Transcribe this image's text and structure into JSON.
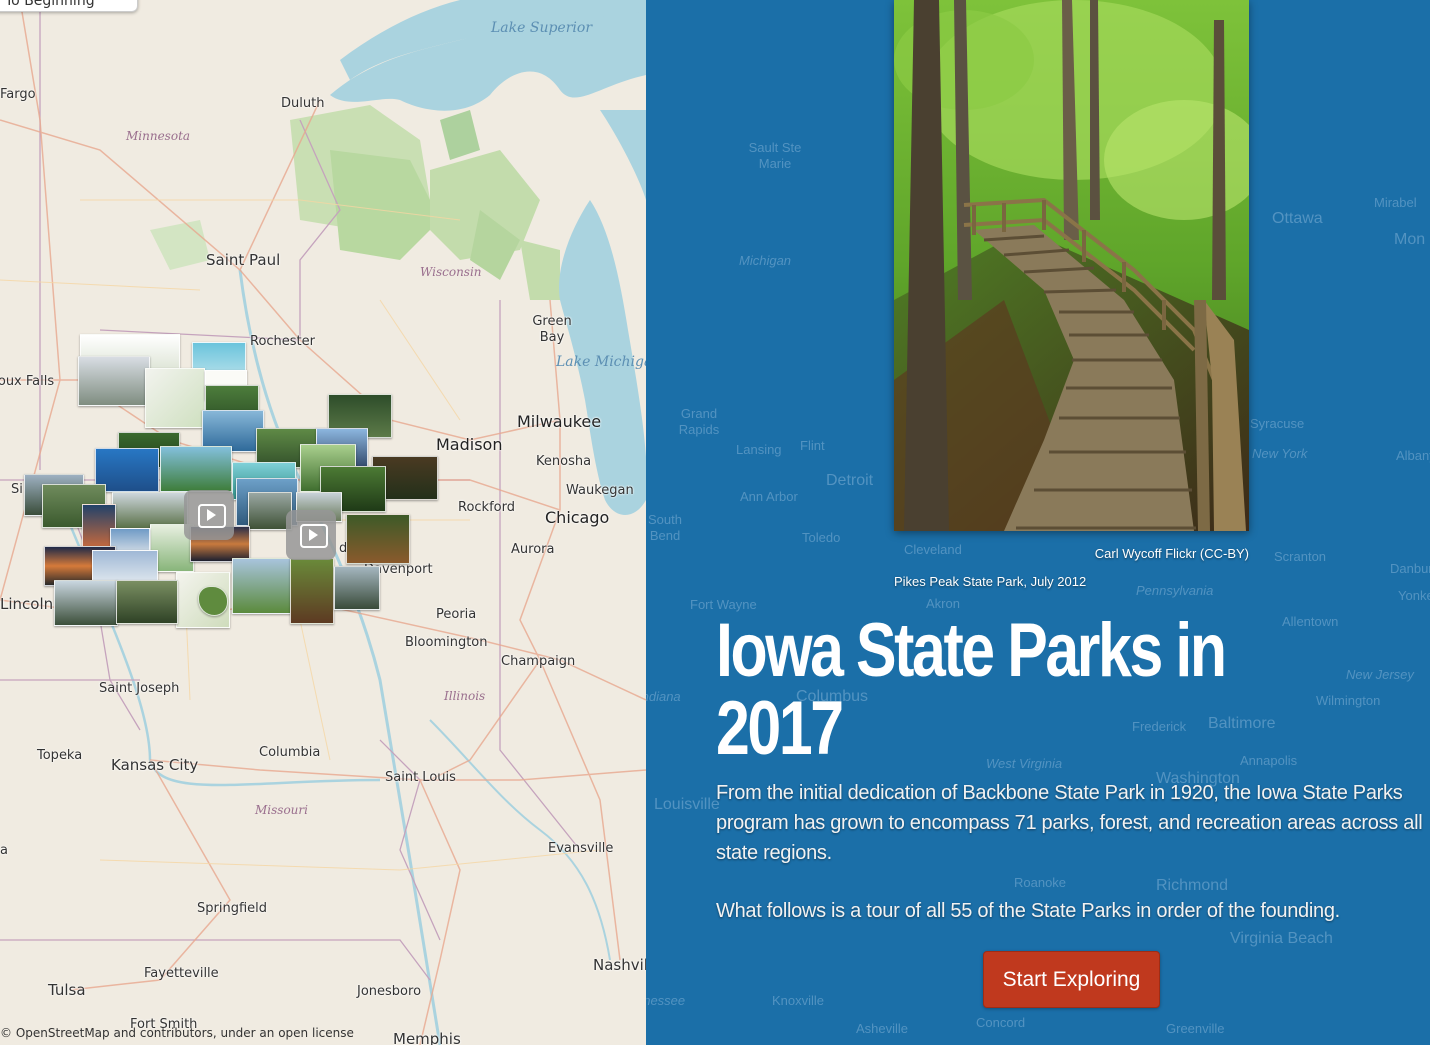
{
  "map": {
    "back_button": "To Beginning",
    "water_labels": [
      "Lake Superior",
      "Lake Michigan"
    ],
    "state_labels": [
      "Minnesota",
      "Wisconsin",
      "Illinois",
      "Missouri"
    ],
    "city_labels": [
      "Fargo",
      "Duluth",
      "Saint Paul",
      "Rochester",
      "Sioux Falls",
      "Green Bay",
      "Madison",
      "Milwaukee",
      "Kenosha",
      "Waukegan",
      "Rockford",
      "Chicago",
      "Aurora",
      "Davenport",
      "Lincoln",
      "Peoria",
      "Bloomington",
      "Champaign",
      "Saint Joseph",
      "Topeka",
      "Kansas City",
      "Columbia",
      "Saint Louis",
      "Evansville",
      "Springfield",
      "Fayetteville",
      "Tulsa",
      "Fort Smith",
      "Jonesboro",
      "Nashville",
      "Memphis",
      "Si",
      "a",
      "d"
    ],
    "attribution": {
      "prefix": "© OpenStreetMap and contributors, under an",
      "link": "open license"
    },
    "video_markers": 2
  },
  "panel": {
    "background_labels": [
      "Sault Ste Marie",
      "Michigan",
      "Grand Rapids",
      "Lansing",
      "Flint",
      "Detroit",
      "Ann Arbor",
      "Toledo",
      "Cleveland",
      "Fort Wayne",
      "South Bend",
      "Akron",
      "Ottawa",
      "Mirabel",
      "Mon",
      "Scranton",
      "Danbury",
      "Yonkers",
      "Albany",
      "Syracuse",
      "New York",
      "Allentown",
      "New Jersey",
      "Wilmington",
      "Frederick",
      "Baltimore",
      "Annapolis",
      "West Virginia",
      "Washington",
      "Louisville",
      "Roanoke",
      "Richmond",
      "Virginia Beach",
      "Knoxville",
      "Asheville",
      "Concord",
      "Greenville",
      "Tennessee",
      "Indiana",
      "Pennsylvania",
      "Columbus"
    ],
    "photo_credit": "Carl Wycoff Flickr (CC-BY)",
    "photo_caption": "Pikes Peak State Park, July 2012",
    "title": "Iowa State Parks in 2017",
    "intro_1": "From the initial dedication of Backbone State Park in 1920, the Iowa State Parks program has grown to encompass 71 parks, forest, and recreation areas across all state regions.",
    "intro_2": "What follows is a tour of all 55 of the State Parks in order of the founding.",
    "start_button": "Start Exploring"
  },
  "colors": {
    "panel_bg": "#1b6fa8",
    "button_bg": "#c0391e",
    "water": "#aad3df",
    "forest": "#add19e"
  }
}
